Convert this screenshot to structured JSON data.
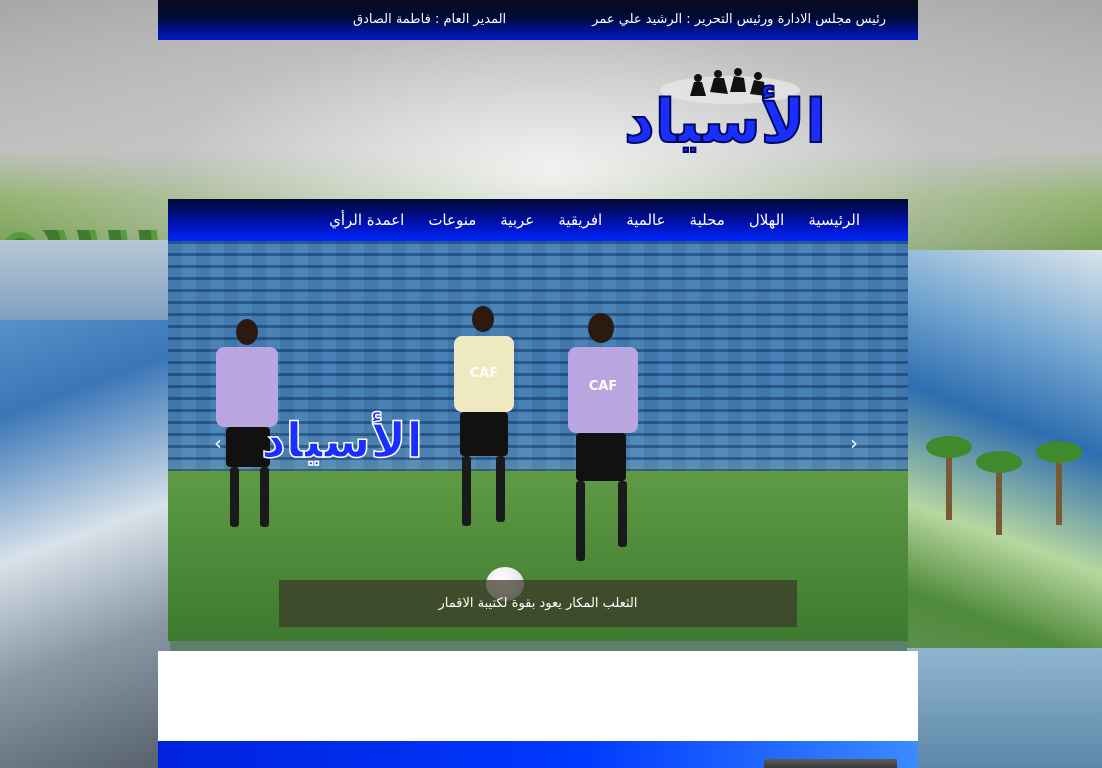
{
  "header": {
    "chairman": "رئيس مجلس الادارة ورئيس التحرير : الرشيد علي عمر",
    "director": "المدير العام : فاطمة الصادق"
  },
  "logo": {
    "text": "الأسياد"
  },
  "nav": {
    "items": [
      "الرئيسية",
      "الهلال",
      "محلية",
      "عالمية",
      "افريقية",
      "عربية",
      "منوعات",
      "اعمدة الرأي"
    ]
  },
  "slider": {
    "caption": "الثعلب المكار يعود بقوة لكتيبة الاقمار",
    "bib_text": "CAF",
    "watermark_text": "الأسياد",
    "prev_icon": "chevron-left-icon",
    "next_icon": "chevron-right-icon",
    "prev_glyph": "‹",
    "next_glyph": "›"
  },
  "colors": {
    "nav_blue": "#0026ff",
    "bib_lavender": "#b9a6e0",
    "bib_cream": "#efe9c2"
  }
}
